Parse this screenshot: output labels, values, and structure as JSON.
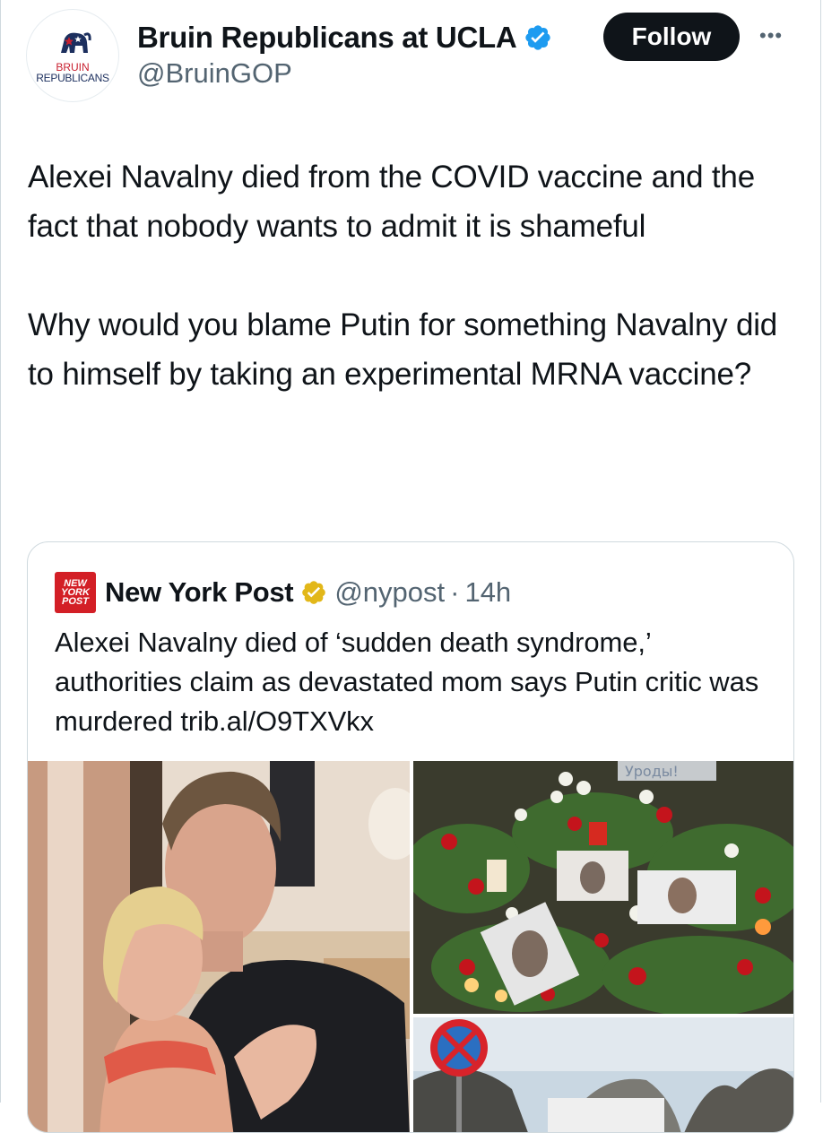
{
  "tweet": {
    "author": {
      "display_name": "Bruin Republicans at UCLA",
      "handle": "@BruinGOP",
      "avatar_text_1": "BRUIN",
      "avatar_text_2": "REPUBLICANS",
      "verified_color": "#1d9bf0"
    },
    "follow_label": "Follow",
    "more_label": "•••",
    "text": "Alexei Navalny died from the COVID vaccine and the fact that nobody wants to admit it is shameful\n\nWhy would you blame Putin for something Navalny did to himself by taking an experimental MRNA vaccine?"
  },
  "quote": {
    "logo_lines": [
      "NEW",
      "YORK",
      "POST"
    ],
    "display_name": "New York Post",
    "badge_color": "#e2b719",
    "handle": "@nypost",
    "separator": "·",
    "time": "14h",
    "text": "Alexei Navalny died of ‘sudden death syndrome,’ authorities claim as devastated mom says Putin critic was murdered trib.al/O9TXVkx",
    "images": [
      {
        "name": "navalny-embrace-photo"
      },
      {
        "name": "memorial-flowers-photo",
        "sign_text": "Уроды!"
      },
      {
        "name": "street-sign-photo"
      }
    ]
  },
  "colors": {
    "text_primary": "#0f1419",
    "text_secondary": "#536471",
    "border": "#cfd9de",
    "follow_bg": "#0f1419"
  }
}
